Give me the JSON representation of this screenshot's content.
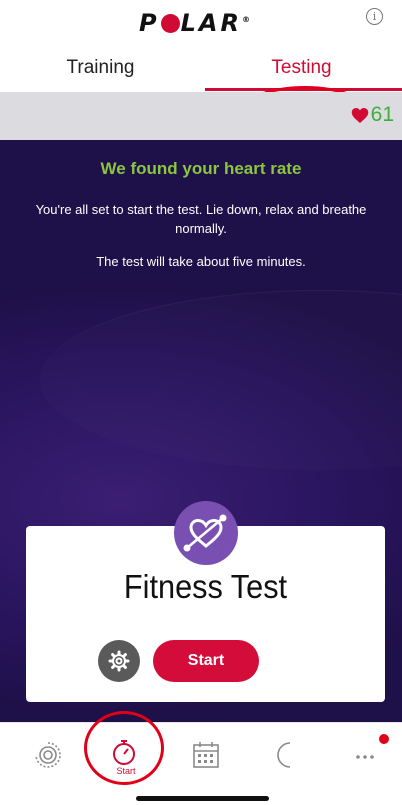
{
  "header": {
    "logo_text": "POLAR",
    "info_icon": "info-icon"
  },
  "tabs": [
    {
      "label": "Training",
      "active": false
    },
    {
      "label": "Testing",
      "active": true
    }
  ],
  "heart_rate": {
    "value": "61",
    "icon": "heart-icon",
    "color": "#d10a34"
  },
  "main": {
    "headline": "We found your heart rate",
    "description": "You're all set to start the test. Lie down, relax and breathe normally.",
    "duration_note": "The test will take about five minutes."
  },
  "card": {
    "badge_icon": "heart-arrow-icon",
    "title": "Fitness Test",
    "settings_icon": "gear-icon",
    "start_label": "Start"
  },
  "nav": {
    "items": [
      {
        "icon": "activity-icon",
        "label": ""
      },
      {
        "icon": "stopwatch-icon",
        "label": "Start"
      },
      {
        "icon": "calendar-icon",
        "label": ""
      },
      {
        "icon": "moon-icon",
        "label": ""
      },
      {
        "icon": "more-icon",
        "label": ""
      }
    ]
  },
  "colors": {
    "accent": "#d10a34",
    "hr_green": "#3fae3f",
    "headline_green": "#8bc63f",
    "purple": "#2a1560"
  }
}
